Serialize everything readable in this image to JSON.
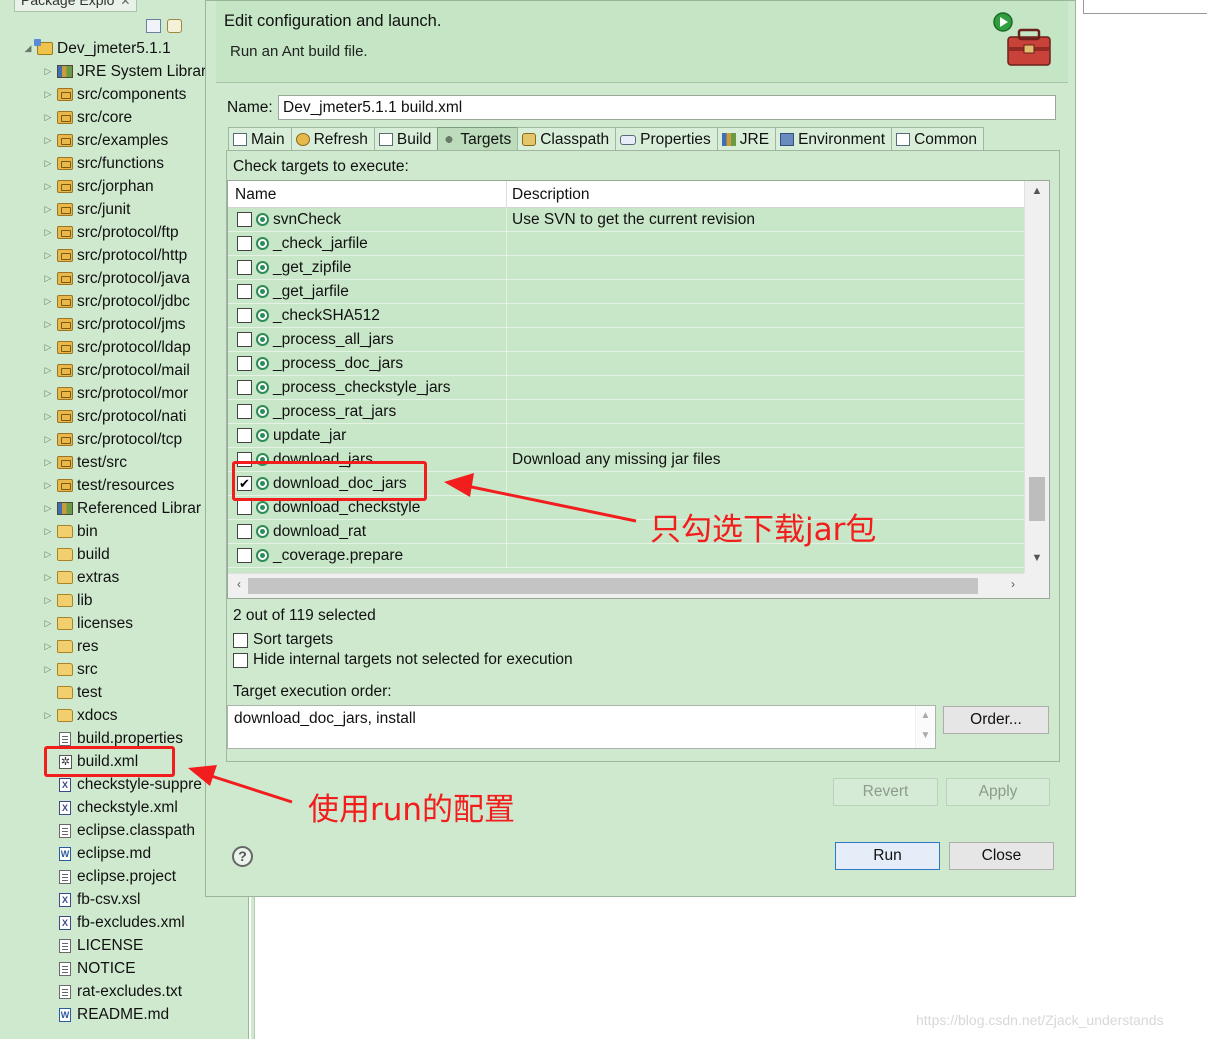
{
  "package_explorer": {
    "tab_title": "Package Explo",
    "tree": [
      {
        "label": "Dev_jmeter5.1.1",
        "icon": "project-icon",
        "twisty": "◢",
        "indent": 0
      },
      {
        "label": "JRE System Librar",
        "icon": "library-icon",
        "twisty": "▷",
        "indent": 1
      },
      {
        "label": "src/components",
        "icon": "package-folder-icon",
        "twisty": "▷",
        "indent": 1
      },
      {
        "label": "src/core",
        "icon": "package-folder-icon",
        "twisty": "▷",
        "indent": 1
      },
      {
        "label": "src/examples",
        "icon": "package-folder-icon",
        "twisty": "▷",
        "indent": 1
      },
      {
        "label": "src/functions",
        "icon": "package-folder-icon",
        "twisty": "▷",
        "indent": 1
      },
      {
        "label": "src/jorphan",
        "icon": "package-folder-icon",
        "twisty": "▷",
        "indent": 1
      },
      {
        "label": "src/junit",
        "icon": "package-folder-icon",
        "twisty": "▷",
        "indent": 1
      },
      {
        "label": "src/protocol/ftp",
        "icon": "package-folder-icon",
        "twisty": "▷",
        "indent": 1
      },
      {
        "label": "src/protocol/http",
        "icon": "package-folder-icon",
        "twisty": "▷",
        "indent": 1
      },
      {
        "label": "src/protocol/java",
        "icon": "package-folder-icon",
        "twisty": "▷",
        "indent": 1
      },
      {
        "label": "src/protocol/jdbc",
        "icon": "package-folder-icon",
        "twisty": "▷",
        "indent": 1
      },
      {
        "label": "src/protocol/jms",
        "icon": "package-folder-icon",
        "twisty": "▷",
        "indent": 1
      },
      {
        "label": "src/protocol/ldap",
        "icon": "package-folder-icon",
        "twisty": "▷",
        "indent": 1
      },
      {
        "label": "src/protocol/mail",
        "icon": "package-folder-icon",
        "twisty": "▷",
        "indent": 1
      },
      {
        "label": "src/protocol/mor",
        "icon": "package-folder-icon",
        "twisty": "▷",
        "indent": 1
      },
      {
        "label": "src/protocol/nati",
        "icon": "package-folder-icon",
        "twisty": "▷",
        "indent": 1
      },
      {
        "label": "src/protocol/tcp",
        "icon": "package-folder-icon",
        "twisty": "▷",
        "indent": 1
      },
      {
        "label": "test/src",
        "icon": "package-folder-icon",
        "twisty": "▷",
        "indent": 1
      },
      {
        "label": "test/resources",
        "icon": "package-folder-icon",
        "twisty": "▷",
        "indent": 1
      },
      {
        "label": "Referenced Librar",
        "icon": "library-icon",
        "twisty": "▷",
        "indent": 1
      },
      {
        "label": "bin",
        "icon": "folder-icon",
        "twisty": "▷",
        "indent": 1
      },
      {
        "label": "build",
        "icon": "folder-icon",
        "twisty": "▷",
        "indent": 1
      },
      {
        "label": "extras",
        "icon": "folder-icon",
        "twisty": "▷",
        "indent": 1
      },
      {
        "label": "lib",
        "icon": "folder-icon",
        "twisty": "▷",
        "indent": 1
      },
      {
        "label": "licenses",
        "icon": "folder-icon",
        "twisty": "▷",
        "indent": 1
      },
      {
        "label": "res",
        "icon": "folder-icon",
        "twisty": "▷",
        "indent": 1
      },
      {
        "label": "src",
        "icon": "folder-icon",
        "twisty": "▷",
        "indent": 1
      },
      {
        "label": "test",
        "icon": "folder-icon",
        "twisty": "",
        "indent": 1
      },
      {
        "label": "xdocs",
        "icon": "folder-icon",
        "twisty": "▷",
        "indent": 1
      },
      {
        "label": "build.properties",
        "icon": "properties-file-icon",
        "twisty": "",
        "indent": 1
      },
      {
        "label": "build.xml",
        "icon": "ant-file-icon",
        "twisty": "",
        "indent": 1
      },
      {
        "label": "checkstyle-suppre",
        "icon": "xml-file-icon",
        "twisty": "",
        "indent": 1
      },
      {
        "label": "checkstyle.xml",
        "icon": "xml-file-icon",
        "twisty": "",
        "indent": 1
      },
      {
        "label": "eclipse.classpath",
        "icon": "text-file-icon",
        "twisty": "",
        "indent": 1
      },
      {
        "label": "eclipse.md",
        "icon": "word-file-icon",
        "twisty": "",
        "indent": 1
      },
      {
        "label": "eclipse.project",
        "icon": "text-file-icon",
        "twisty": "",
        "indent": 1
      },
      {
        "label": "fb-csv.xsl",
        "icon": "xsl-file-icon",
        "twisty": "",
        "indent": 1
      },
      {
        "label": "fb-excludes.xml",
        "icon": "xml-file-icon",
        "twisty": "",
        "indent": 1
      },
      {
        "label": "LICENSE",
        "icon": "text-file-icon",
        "twisty": "",
        "indent": 1
      },
      {
        "label": "NOTICE",
        "icon": "text-file-icon",
        "twisty": "",
        "indent": 1
      },
      {
        "label": "rat-excludes.txt",
        "icon": "text-file-icon",
        "twisty": "",
        "indent": 1
      },
      {
        "label": "README.md",
        "icon": "word-file-icon",
        "twisty": "",
        "indent": 1
      }
    ]
  },
  "dialog": {
    "title": "Edit configuration and launch.",
    "subtitle": "Run an Ant build file.",
    "banner_icon": "ant-toolbox-run-icon",
    "name_label": "Name:",
    "name_value": "Dev_jmeter5.1.1 build.xml",
    "tabs": [
      {
        "label": "Main",
        "icon": "main-icon"
      },
      {
        "label": "Refresh",
        "icon": "refresh-icon"
      },
      {
        "label": "Build",
        "icon": "build-icon"
      },
      {
        "label": "Targets",
        "icon": "targets-icon",
        "active": true
      },
      {
        "label": "Classpath",
        "icon": "classpath-icon"
      },
      {
        "label": "Properties",
        "icon": "properties-icon"
      },
      {
        "label": "JRE",
        "icon": "jre-icon"
      },
      {
        "label": "Environment",
        "icon": "environment-icon"
      },
      {
        "label": "Common",
        "icon": "common-icon"
      }
    ],
    "check_targets_label": "Check targets to execute:",
    "columns": {
      "name": "Name",
      "description": "Description"
    },
    "targets": [
      {
        "name": "svnCheck",
        "description": "Use SVN to get the current revision",
        "checked": false
      },
      {
        "name": "_check_jarfile",
        "description": "",
        "checked": false
      },
      {
        "name": "_get_zipfile",
        "description": "",
        "checked": false
      },
      {
        "name": "_get_jarfile",
        "description": "",
        "checked": false
      },
      {
        "name": "_checkSHA512",
        "description": "",
        "checked": false
      },
      {
        "name": "_process_all_jars",
        "description": "",
        "checked": false
      },
      {
        "name": "_process_doc_jars",
        "description": "",
        "checked": false
      },
      {
        "name": "_process_checkstyle_jars",
        "description": "",
        "checked": false
      },
      {
        "name": "_process_rat_jars",
        "description": "",
        "checked": false
      },
      {
        "name": "update_jar",
        "description": "",
        "checked": false
      },
      {
        "name": "download_jars",
        "description": "Download any missing jar files",
        "checked": false
      },
      {
        "name": "download_doc_jars",
        "description": "",
        "checked": true
      },
      {
        "name": "download_checkstyle",
        "description": "",
        "checked": false
      },
      {
        "name": "download_rat",
        "description": "",
        "checked": false
      },
      {
        "name": "_coverage.prepare",
        "description": "",
        "checked": false
      }
    ],
    "selection_status": "2 out of 119 selected",
    "sort_targets_label": "Sort targets",
    "hide_internal_label": "Hide internal targets not selected for execution",
    "execution_order_label": "Target execution order:",
    "execution_order_value": "download_doc_jars, install",
    "order_button": "Order...",
    "revert_button": "Revert",
    "apply_button": "Apply",
    "run_button": "Run",
    "close_button": "Close",
    "help_icon": "?"
  },
  "annotations": {
    "target_note": "只勾选下载jar包",
    "buildxml_note": "使用run的配置",
    "color": "#f21d1d"
  },
  "watermark": "https://blog.csdn.net/Zjack_understands"
}
